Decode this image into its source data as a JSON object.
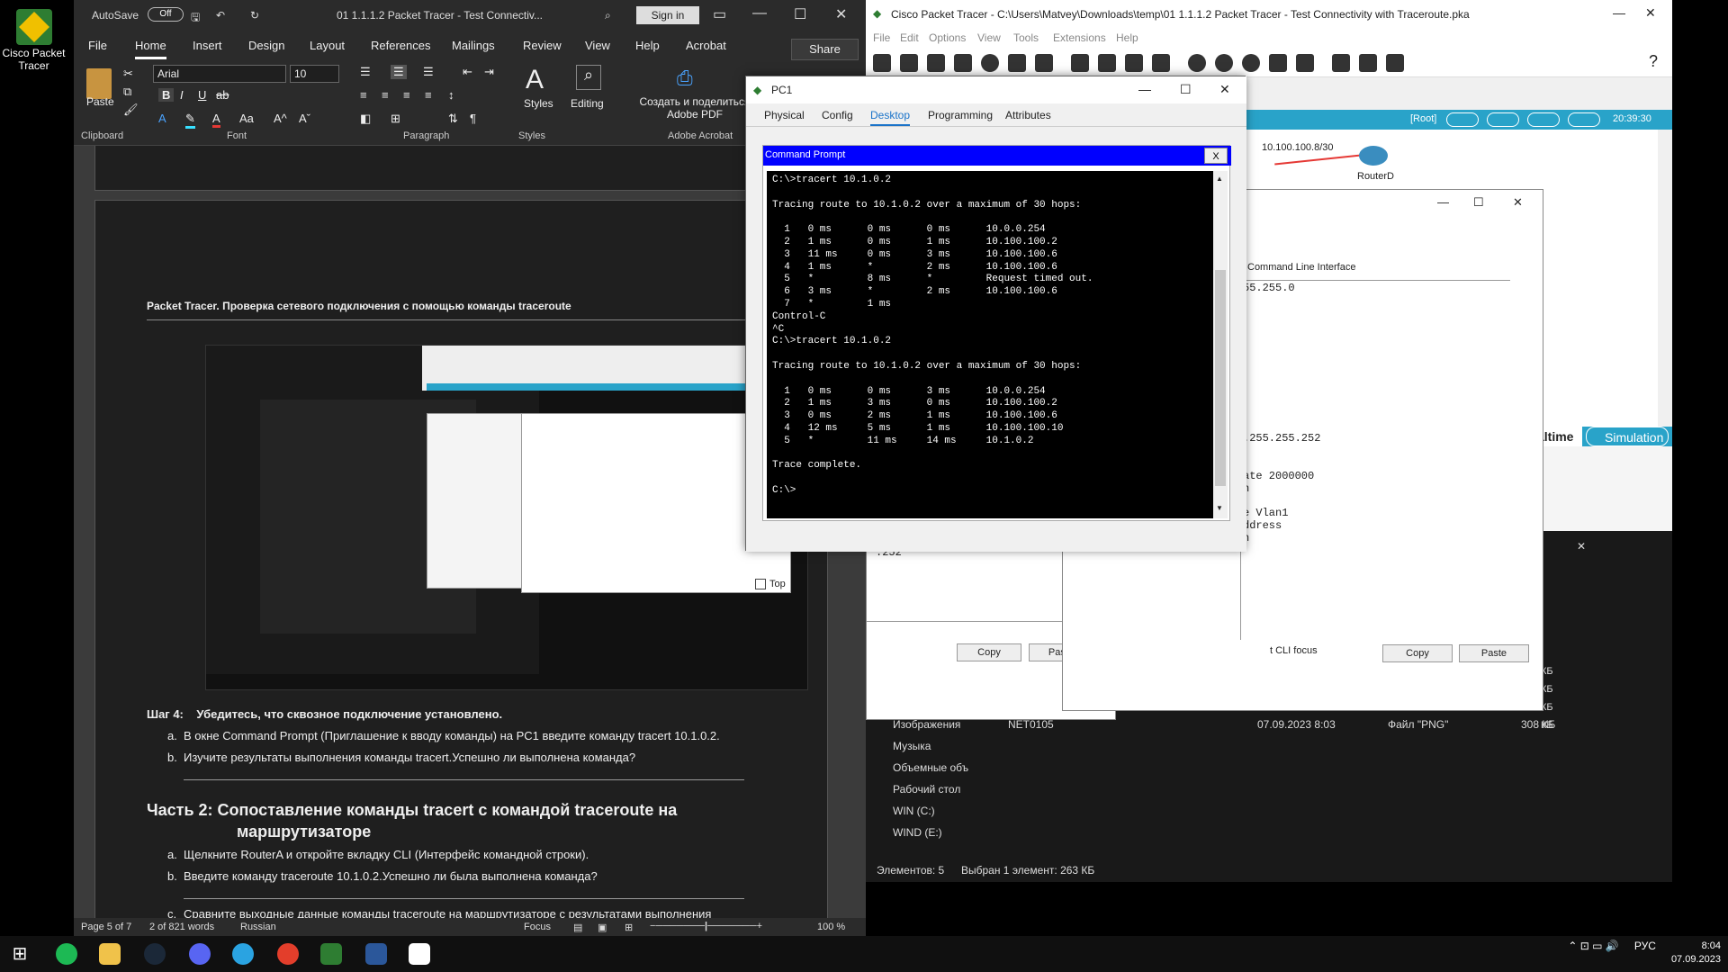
{
  "desktop": {
    "icon_label": "Cisco Packet Tracer"
  },
  "word": {
    "title": {
      "autosave": "AutoSave",
      "autosave_state": "Off",
      "doc": "01 1.1.1.2 Packet Tracer - Test Connectiv...",
      "signin": "Sign in"
    },
    "menu": [
      "File",
      "Home",
      "Insert",
      "Design",
      "Layout",
      "References",
      "Mailings",
      "Review",
      "View",
      "Help",
      "Acrobat"
    ],
    "share": "Share",
    "ribbon": {
      "font_name": "Arial",
      "font_size": "10",
      "paste": "Paste",
      "styles": "Styles",
      "editing": "Editing",
      "adobe": "Создать и поделиться\nAdobe PDF",
      "groups": [
        "Clipboard",
        "Font",
        "Paragraph",
        "Styles",
        "Adobe Acrobat"
      ]
    },
    "doc": {
      "header": "Packet Tracer. Проверка сетевого подключения с помощью команды traceroute",
      "step4_title": "Шаг 4:    Убедитесь, что сквозное подключение установлено.",
      "step4_a_prefix": "a.",
      "step4_a": "В окне Command Prompt (Приглашение к вводу команды) на PC1 введите команду tracert 10.1.0.2.",
      "step4_b_prefix": "b.",
      "step4_b": "Изучите результаты выполнения команды tracert.Успешно ли выполнена команда?",
      "part2_title": "Часть 2: Сопоставление команды tracert с командой traceroute на",
      "part2_title2": "маршрутизаторе",
      "p2_a_prefix": "a.",
      "p2_a": "Щелкните RouterA и откройте вкладку CLI (Интерфейс командной строки).",
      "p2_b_prefix": "b.",
      "p2_b": "Введите команду traceroute 10.1.0.2.Успешно ли была выполнена команда?",
      "p2_c_prefix": "c.",
      "p2_c": "Сравните выходные данные команды traceroute на маршрутизаторе с результатами выполнения команды tracert на компьютере.Какие существенные отличия имеются в списке полученных адресов?"
    },
    "status": {
      "page": "Page 5 of 7",
      "words": "2 of 821 words",
      "lang": "Russian",
      "focus": "Focus",
      "zoom": "100 %"
    }
  },
  "pt": {
    "title": "Cisco Packet Tracer - C:\\Users\\Matvey\\Downloads\\temp\\01 1.1.1.2 Packet Tracer - Test Connectivity with Traceroute.pka",
    "menu": [
      "File",
      "Edit",
      "Options",
      "View",
      "Tools",
      "Extensions",
      "Help"
    ],
    "root": "[Root]",
    "time": "20:39:30",
    "network_label": "10.100.100.8/30",
    "router_label": "RouterD",
    "realtime": "altime",
    "simulation": "Simulation",
    "cli_title": "Command Line Interface",
    "cli_lines": [
      "55.255.0",
      "",
      "",
      "",
      "",
      "",
      "",
      "",
      "",
      "",
      "",
      "",
      ".255.255.252",
      "",
      "",
      "ate 2000000",
      "n",
      "",
      "e Vlan1",
      "ddress",
      "n"
    ],
    "copy": "Copy",
    "paste": "Paste",
    "cli_focus": "t CLI focus",
    "routerB_line": ".252",
    "explorer": {
      "sizes": [
        "КБ",
        "КБ",
        "КБ",
        "КБ"
      ],
      "nav": [
        "Изображения",
        "Музыка",
        "Объемные объ",
        "Рабочий стол",
        "WIN (C:)",
        "WIND (E:)"
      ],
      "file": {
        "name": "NET0105",
        "date": "07.09.2023 8:03",
        "type": "Файл \"PNG\"",
        "size": "308 КБ"
      },
      "status_count": "Элементов: 5",
      "status_sel": "Выбран 1 элемент: 263 КБ"
    }
  },
  "pc1": {
    "title": "PC1",
    "tabs": [
      "Physical",
      "Config",
      "Desktop",
      "Programming",
      "Attributes"
    ],
    "cmd_title": "Command Prompt",
    "cmd_close": "X",
    "cmd_output": "C:\\>tracert 10.1.0.2\n\nTracing route to 10.1.0.2 over a maximum of 30 hops:\n\n  1   0 ms      0 ms      0 ms      10.0.0.254\n  2   1 ms      0 ms      1 ms      10.100.100.2\n  3   11 ms     0 ms      3 ms      10.100.100.6\n  4   1 ms      *         2 ms      10.100.100.6\n  5   *         8 ms      *         Request timed out.\n  6   3 ms      *         2 ms      10.100.100.6\n  7   *         1 ms\nControl-C\n^C\nC:\\>tracert 10.1.0.2\n\nTracing route to 10.1.0.2 over a maximum of 30 hops:\n\n  1   0 ms      0 ms      3 ms      10.0.0.254\n  2   1 ms      3 ms      0 ms      10.100.100.2\n  3   0 ms      2 ms      1 ms      10.100.100.6\n  4   12 ms     5 ms      1 ms      10.100.100.10\n  5   *         11 ms     14 ms     10.1.0.2\n\nTrace complete.\n\nC:\\>",
    "top_label": "Top"
  },
  "taskbar": {
    "lang": "РУС",
    "time": "8:04",
    "date": "07.09.2023"
  }
}
